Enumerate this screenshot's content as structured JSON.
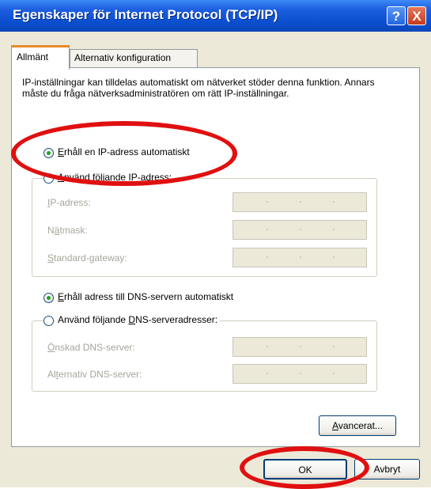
{
  "window": {
    "title": "Egenskaper för Internet Protocol (TCP/IP)",
    "help_glyph": "?",
    "close_glyph": "X"
  },
  "tabs": [
    {
      "label": "Allmänt"
    },
    {
      "label": "Alternativ konfiguration"
    }
  ],
  "description": "IP-inställningar kan tilldelas automatiskt om nätverket stöder denna funktion. Annars måste du fråga nätverksadministratören om rätt IP-inställningar.",
  "ip": {
    "auto": {
      "prefix": "",
      "ul": "E",
      "rest": "rhåll en IP-adress automatiskt",
      "checked": true
    },
    "manual": {
      "prefix": "",
      "ul": "A",
      "rest": "nvänd följande IP-adress:",
      "checked": false
    },
    "fields": [
      {
        "prefix": "",
        "ul": "I",
        "rest": "P-adress:"
      },
      {
        "prefix": "N",
        "ul": "ä",
        "rest": "tmask:"
      },
      {
        "prefix": "",
        "ul": "S",
        "rest": "tandard-gateway:"
      }
    ]
  },
  "dns": {
    "auto": {
      "prefix": "",
      "ul": "E",
      "rest": "rhåll adress till DNS-servern automatiskt",
      "checked": true
    },
    "manual": {
      "prefix": "Använd följande ",
      "ul": "D",
      "rest": "NS-serveradresser:",
      "checked": false
    },
    "fields": [
      {
        "prefix": "",
        "ul": "Ö",
        "rest": "nskad DNS-server:"
      },
      {
        "prefix": "Al",
        "ul": "t",
        "rest": "ernativ DNS-server:"
      }
    ]
  },
  "buttons": {
    "advanced": {
      "ul": "A",
      "rest": "vancerat..."
    },
    "ok": "OK",
    "cancel": "Avbryt"
  },
  "colors": {
    "annotation": "#E01010",
    "title_bar": "#0A4FD0",
    "dialog_bg": "#ECE9D8"
  }
}
